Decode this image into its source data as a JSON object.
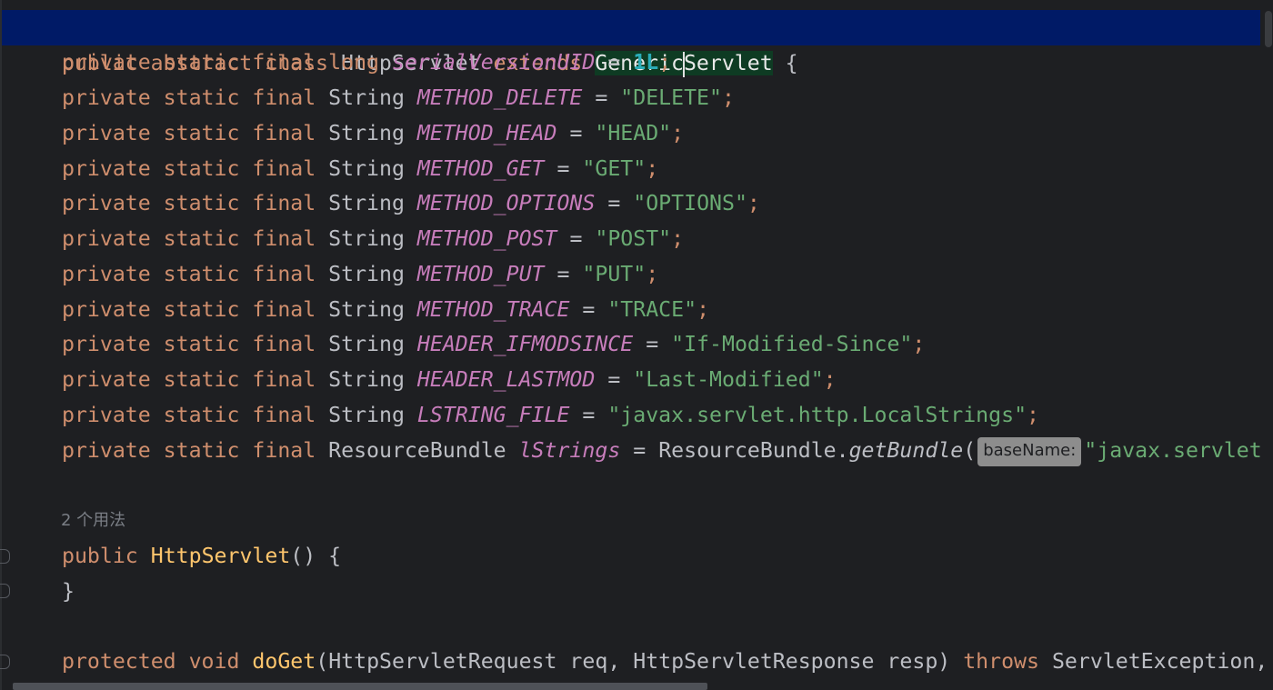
{
  "editor": {
    "lines": {
      "l0": {
        "kw1": "public abstract class",
        "name": "HttpServlet",
        "kw2": "extends",
        "super_a": "Generic",
        "super_b": "Servlet",
        "brace": "{"
      },
      "l1": {
        "mods": "private static final",
        "type": "long",
        "field": "serialVersionUID",
        "eq": "=",
        "num": "1L",
        "semi": ";"
      },
      "l2": {
        "mods": "private static final",
        "type": "String",
        "field": "METHOD_DELETE",
        "eq": "=",
        "str": "\"DELETE\"",
        "semi": ";"
      },
      "l3": {
        "mods": "private static final",
        "type": "String",
        "field": "METHOD_HEAD",
        "eq": "=",
        "str": "\"HEAD\"",
        "semi": ";"
      },
      "l4": {
        "mods": "private static final",
        "type": "String",
        "field": "METHOD_GET",
        "eq": "=",
        "str": "\"GET\"",
        "semi": ";"
      },
      "l5": {
        "mods": "private static final",
        "type": "String",
        "field": "METHOD_OPTIONS",
        "eq": "=",
        "str": "\"OPTIONS\"",
        "semi": ";"
      },
      "l6": {
        "mods": "private static final",
        "type": "String",
        "field": "METHOD_POST",
        "eq": "=",
        "str": "\"POST\"",
        "semi": ";"
      },
      "l7": {
        "mods": "private static final",
        "type": "String",
        "field": "METHOD_PUT",
        "eq": "=",
        "str": "\"PUT\"",
        "semi": ";"
      },
      "l8": {
        "mods": "private static final",
        "type": "String",
        "field": "METHOD_TRACE",
        "eq": "=",
        "str": "\"TRACE\"",
        "semi": ";"
      },
      "l9": {
        "mods": "private static final",
        "type": "String",
        "field": "HEADER_IFMODSINCE",
        "eq": "=",
        "str": "\"If-Modified-Since\"",
        "semi": ";"
      },
      "l10": {
        "mods": "private static final",
        "type": "String",
        "field": "HEADER_LASTMOD",
        "eq": "=",
        "str": "\"Last-Modified\"",
        "semi": ";"
      },
      "l11": {
        "mods": "private static final",
        "type": "String",
        "field": "LSTRING_FILE",
        "eq": "=",
        "str": "\"javax.servlet.http.LocalStrings\"",
        "semi": ";"
      },
      "l12": {
        "mods": "private static final",
        "type": "ResourceBundle",
        "field": "lStrings",
        "eq": "=",
        "cls": "ResourceBundle.",
        "method": "getBundle",
        "paren": "(",
        "hint": "baseName:",
        "str": "\"javax.servlet"
      },
      "l13": {
        "kw": "public",
        "name": "HttpServlet",
        "rest": "() {"
      },
      "l14": {
        "brace": "}"
      },
      "l15": {
        "kw": "protected void",
        "name": "doGet",
        "args": "(HttpServletRequest req, HttpServletResponse resp)",
        "throws": "throws",
        "exc": "ServletException,"
      }
    },
    "usage_hint": "2 个用法"
  },
  "colors": {
    "background": "#1e1f22",
    "keyword": "#cf8e6d",
    "field": "#c77dbb",
    "string": "#6aab73",
    "number": "#2aacb8",
    "method_decl": "#ffc66d",
    "current_line": "#001a66",
    "selection": "#0e3b23"
  }
}
